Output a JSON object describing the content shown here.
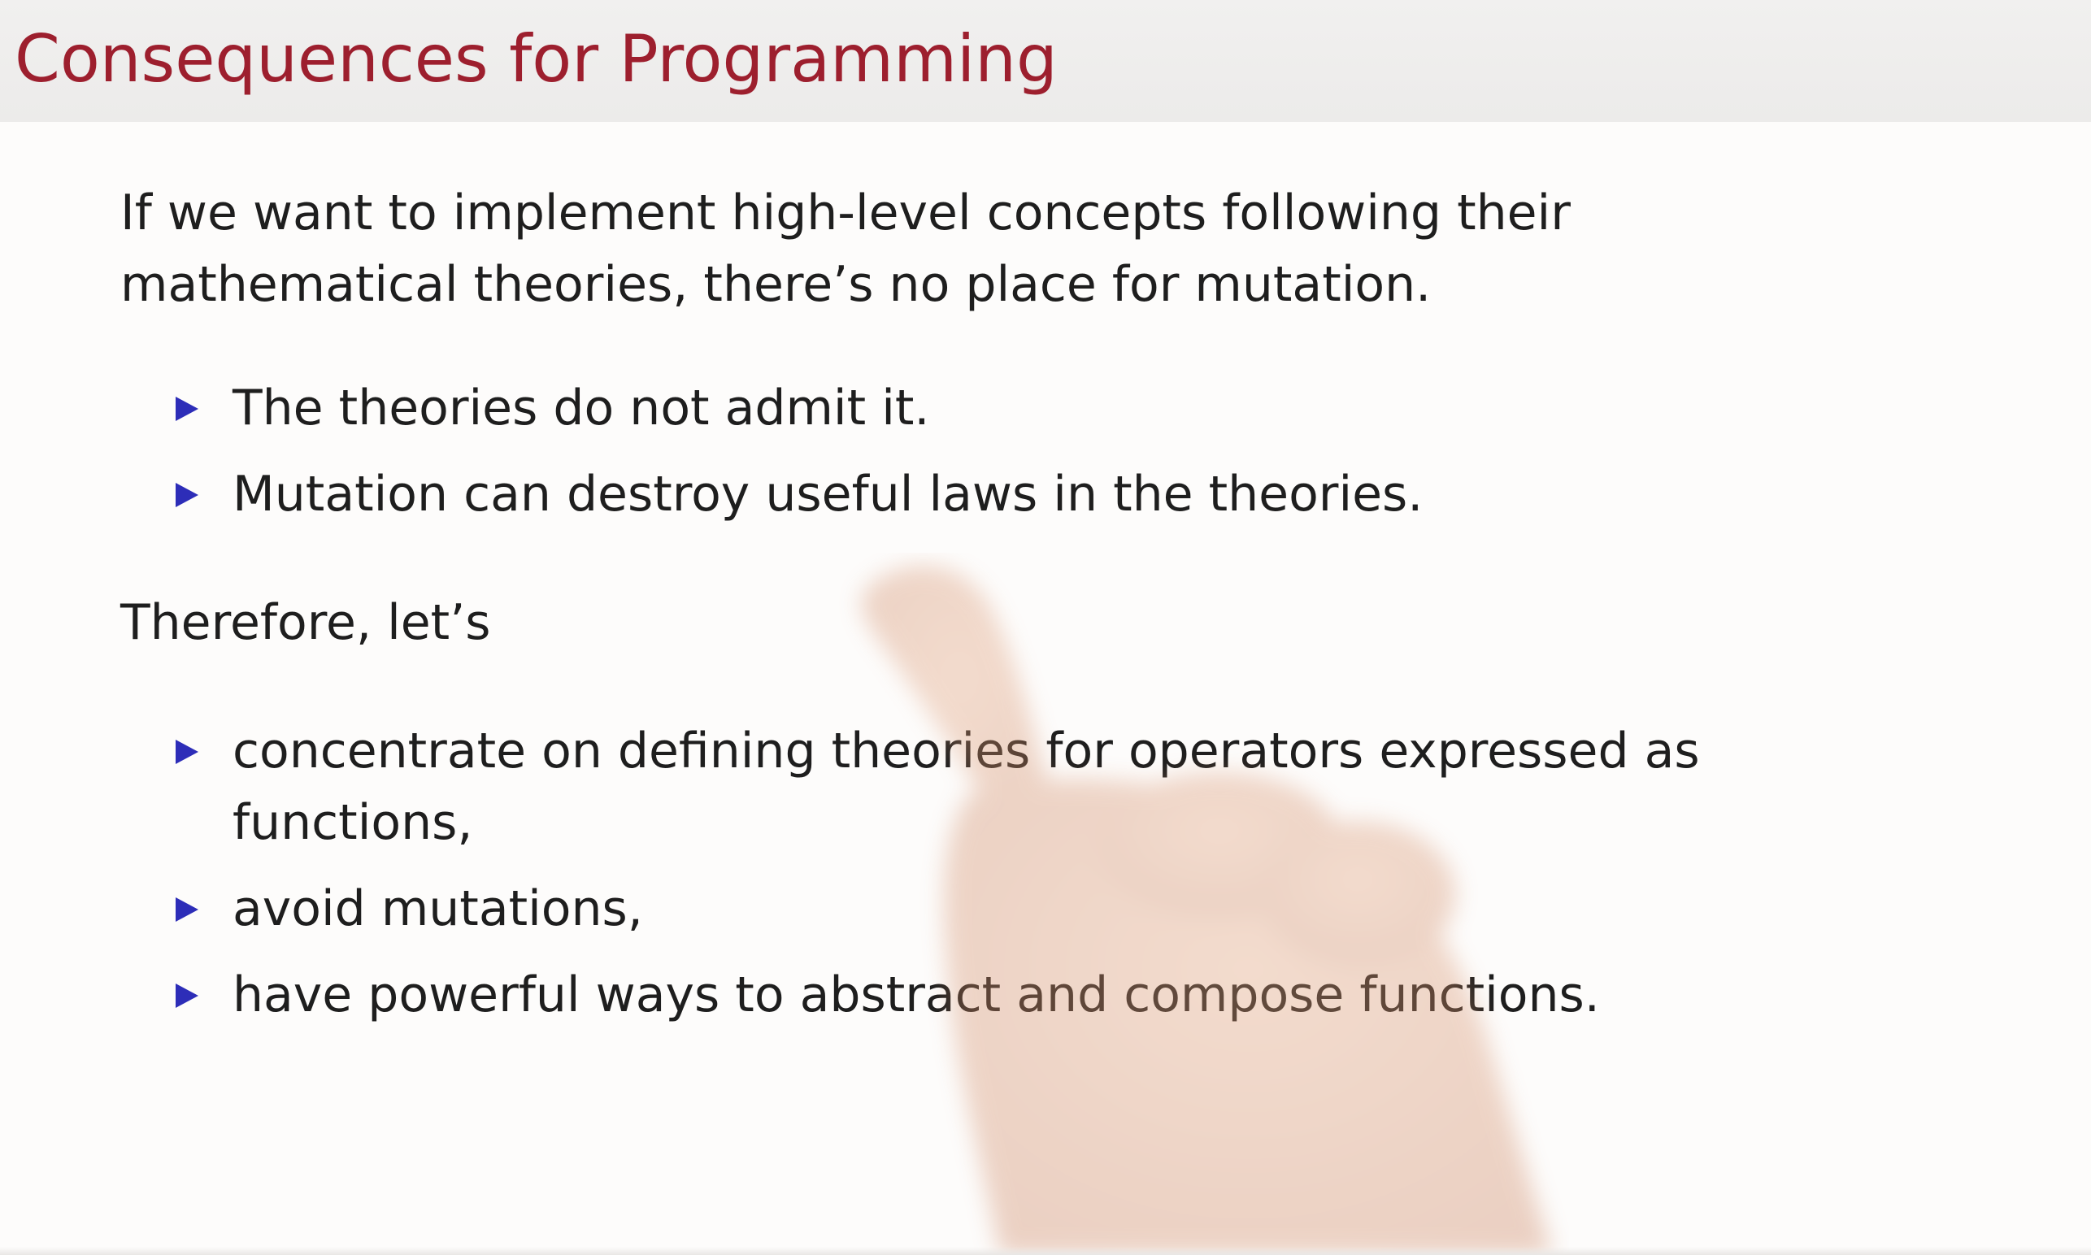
{
  "slide": {
    "title": "Consequences for Programming",
    "intro": "If we want to implement high-level concepts following their mathematical theories, there’s no place for mutation.",
    "reasons": [
      "The theories do not admit it.",
      "Mutation can destroy useful laws in the theories."
    ],
    "therefore": "Therefore, let’s",
    "actions": [
      "concentrate on defining theories for operators expressed as functions,",
      "avoid mutations,",
      "have powerful ways to abstract and compose functions."
    ]
  },
  "colors": {
    "title": "#9d1f2e",
    "title_bar": "#efeeed",
    "bullet": "#2d2db8",
    "text": "#1e1e1e",
    "background": "#fdfcfb"
  },
  "icons": {
    "bullet": "triangle-bullet-icon",
    "overlay": "pointing-hand-icon"
  }
}
